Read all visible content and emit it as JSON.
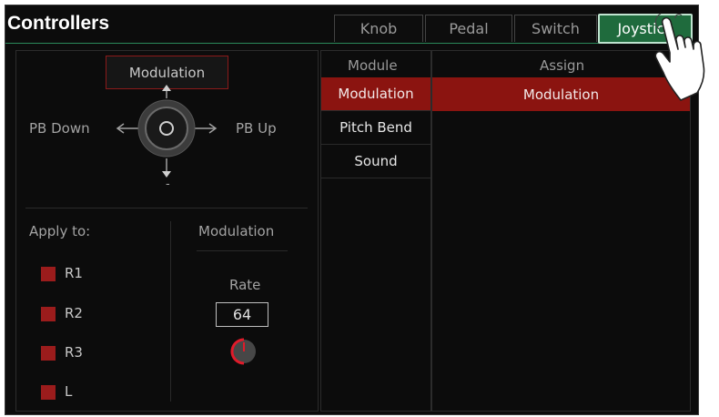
{
  "header": {
    "title": "Controllers",
    "tabs": [
      {
        "label": "Knob",
        "active": false
      },
      {
        "label": "Pedal",
        "active": false
      },
      {
        "label": "Switch",
        "active": false
      },
      {
        "label": "Joystick",
        "active": true
      }
    ]
  },
  "joystick": {
    "top_label": "Modulation",
    "left_label": "PB Down",
    "right_label": "PB Up",
    "bottom_label": "-"
  },
  "apply_to": {
    "title": "Apply to:",
    "parts": [
      {
        "label": "R1",
        "checked": true
      },
      {
        "label": "R2",
        "checked": true
      },
      {
        "label": "R3",
        "checked": true
      },
      {
        "label": "L",
        "checked": true
      }
    ]
  },
  "modulation": {
    "title": "Modulation",
    "rate_label": "Rate",
    "rate_value": "64"
  },
  "table": {
    "module_header": "Module",
    "assign_header": "Assign",
    "modules": [
      {
        "label": "Modulation",
        "selected": true
      },
      {
        "label": "Pitch Bend",
        "selected": false
      },
      {
        "label": "Sound",
        "selected": false
      }
    ],
    "assign_rows": [
      {
        "label": "Modulation",
        "selected": true
      }
    ]
  },
  "colors": {
    "accent_red": "#8b1410",
    "tab_active_green": "#1f6b3d",
    "background": "#0c0c0c"
  },
  "icons": [
    "joystick-knob-icon",
    "arrow-up-icon",
    "arrow-down-icon",
    "arrow-left-icon",
    "arrow-right-icon",
    "rate-knob-icon",
    "hand-pointer-icon"
  ]
}
